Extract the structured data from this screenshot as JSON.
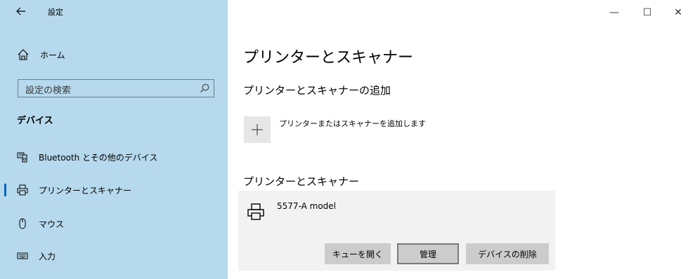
{
  "window": {
    "title": "設定",
    "back_icon": "arrow-left-icon",
    "controls": {
      "minimize": "—",
      "maximize": "☐",
      "close": "✕"
    }
  },
  "sidebar": {
    "home_label": "ホーム",
    "search_placeholder": "設定の検索",
    "section_label": "デバイス",
    "items": [
      {
        "label": "Bluetooth とその他のデバイス",
        "icon": "bluetooth-devices-icon"
      },
      {
        "label": "プリンターとスキャナー",
        "icon": "printer-icon",
        "active": true
      },
      {
        "label": "マウス",
        "icon": "mouse-icon"
      },
      {
        "label": "入力",
        "icon": "keyboard-icon"
      }
    ]
  },
  "main": {
    "page_title": "プリンターとスキャナー",
    "add_heading": "プリンターとスキャナーの追加",
    "add_label": "プリンターまたはスキャナーを追加します",
    "list_heading": "プリンターとスキャナー",
    "printers": [
      {
        "name": "5577-A model",
        "buttons": [
          "キューを開く",
          "管理",
          "デバイスの削除"
        ]
      }
    ]
  },
  "colors": {
    "sidebar_bg": "#b6d9ed",
    "accent": "#0067c0",
    "card_bg": "#f2f2f2",
    "button_bg": "#cccccc"
  }
}
